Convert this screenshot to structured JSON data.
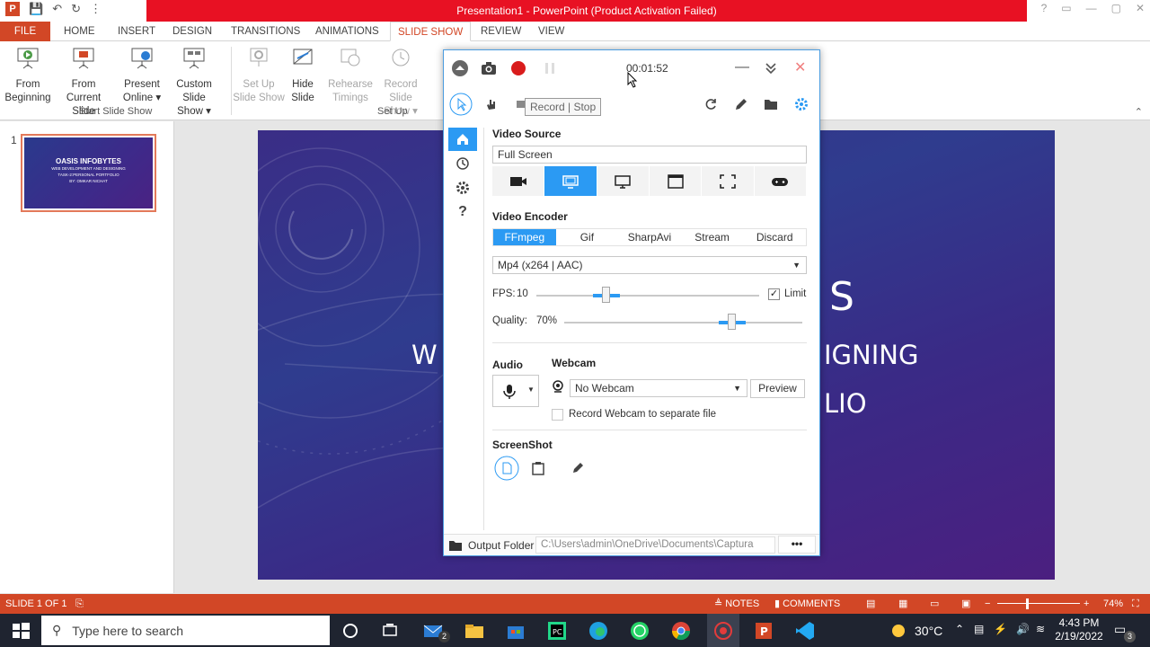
{
  "window": {
    "title": "Presentation1 - PowerPoint (Product Activation Failed)"
  },
  "ribbon_tabs": [
    "FILE",
    "HOME",
    "INSERT",
    "DESIGN",
    "TRANSITIONS",
    "ANIMATIONS",
    "SLIDE SHOW",
    "REVIEW",
    "VIEW"
  ],
  "ribbon": {
    "from_beginning": [
      "From",
      "Beginning"
    ],
    "from_current": [
      "From",
      "Current Slide"
    ],
    "present_online": [
      "Present",
      "Online ▾"
    ],
    "custom_show": [
      "Custom Slide",
      "Show ▾"
    ],
    "setup_show": [
      "Set Up",
      "Slide Show"
    ],
    "hide_slide": [
      "Hide",
      "Slide"
    ],
    "rehearse": [
      "Rehearse",
      "Timings"
    ],
    "record": [
      "Record Slide",
      "Show ▾"
    ],
    "group_start": "Start Slide Show",
    "group_setup": "Set Up"
  },
  "thumbnails": {
    "number": "1",
    "title": "OASIS INFOBYTES",
    "line1": "WEB DEVELOPMENT AND DESIGNING",
    "line2": "TASK-2:PERSONAL PORTFOLIO",
    "line3": "BY: OMKAR NICHAT"
  },
  "slide": {
    "frag_s": "S",
    "frag_w": "W",
    "frag_igning": "IGNING",
    "frag_lio": "LIO"
  },
  "statusbar": {
    "slide_of": "SLIDE 1 OF 1",
    "notes": "NOTES",
    "comments": "COMMENTS",
    "zoom": "74%"
  },
  "taskbar": {
    "search_placeholder": "Type here to search",
    "weather": "30°C",
    "time": "4:43 PM",
    "date": "2/19/2022",
    "mail_badge": "2",
    "notif_badge": "3"
  },
  "captura": {
    "timer": "00:01:52",
    "tooltip": "Record | Stop",
    "video_source_title": "Video Source",
    "video_source_value": "Full Screen",
    "video_encoder_title": "Video Encoder",
    "encoders": [
      "FFmpeg",
      "Gif",
      "SharpAvi",
      "Stream",
      "Discard"
    ],
    "codec": "Mp4 (x264 | AAC)",
    "fps_label": "FPS:",
    "fps_value": "10",
    "fps_fraction": 0.31,
    "limit_label": "Limit",
    "limit_checked": true,
    "quality_label": "Quality:",
    "quality_value": "70%",
    "quality_fraction": 0.7,
    "audio_title": "Audio",
    "webcam_title": "Webcam",
    "webcam_value": "No Webcam",
    "preview_label": "Preview",
    "separate_file_label": "Record Webcam to separate file",
    "screenshot_title": "ScreenShot",
    "output_folder_label": "Output Folder",
    "output_path": "C:\\Users\\admin\\OneDrive\\Documents\\Captura",
    "more_label": "•••"
  },
  "colors": {
    "ppt_orange": "#d24726",
    "accent_blue": "#2b9af3",
    "title_red": "#e81123"
  }
}
